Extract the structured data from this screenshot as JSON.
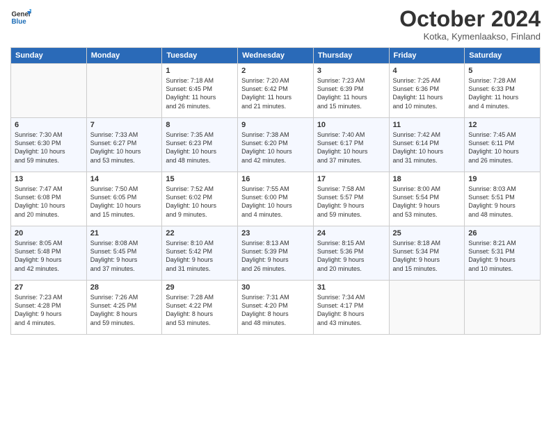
{
  "header": {
    "logo_general": "General",
    "logo_blue": "Blue",
    "month_title": "October 2024",
    "location": "Kotka, Kymenlaakso, Finland"
  },
  "columns": [
    "Sunday",
    "Monday",
    "Tuesday",
    "Wednesday",
    "Thursday",
    "Friday",
    "Saturday"
  ],
  "weeks": [
    [
      {
        "day": "",
        "info": ""
      },
      {
        "day": "",
        "info": ""
      },
      {
        "day": "1",
        "info": "Sunrise: 7:18 AM\nSunset: 6:45 PM\nDaylight: 11 hours\nand 26 minutes."
      },
      {
        "day": "2",
        "info": "Sunrise: 7:20 AM\nSunset: 6:42 PM\nDaylight: 11 hours\nand 21 minutes."
      },
      {
        "day": "3",
        "info": "Sunrise: 7:23 AM\nSunset: 6:39 PM\nDaylight: 11 hours\nand 15 minutes."
      },
      {
        "day": "4",
        "info": "Sunrise: 7:25 AM\nSunset: 6:36 PM\nDaylight: 11 hours\nand 10 minutes."
      },
      {
        "day": "5",
        "info": "Sunrise: 7:28 AM\nSunset: 6:33 PM\nDaylight: 11 hours\nand 4 minutes."
      }
    ],
    [
      {
        "day": "6",
        "info": "Sunrise: 7:30 AM\nSunset: 6:30 PM\nDaylight: 10 hours\nand 59 minutes."
      },
      {
        "day": "7",
        "info": "Sunrise: 7:33 AM\nSunset: 6:27 PM\nDaylight: 10 hours\nand 53 minutes."
      },
      {
        "day": "8",
        "info": "Sunrise: 7:35 AM\nSunset: 6:23 PM\nDaylight: 10 hours\nand 48 minutes."
      },
      {
        "day": "9",
        "info": "Sunrise: 7:38 AM\nSunset: 6:20 PM\nDaylight: 10 hours\nand 42 minutes."
      },
      {
        "day": "10",
        "info": "Sunrise: 7:40 AM\nSunset: 6:17 PM\nDaylight: 10 hours\nand 37 minutes."
      },
      {
        "day": "11",
        "info": "Sunrise: 7:42 AM\nSunset: 6:14 PM\nDaylight: 10 hours\nand 31 minutes."
      },
      {
        "day": "12",
        "info": "Sunrise: 7:45 AM\nSunset: 6:11 PM\nDaylight: 10 hours\nand 26 minutes."
      }
    ],
    [
      {
        "day": "13",
        "info": "Sunrise: 7:47 AM\nSunset: 6:08 PM\nDaylight: 10 hours\nand 20 minutes."
      },
      {
        "day": "14",
        "info": "Sunrise: 7:50 AM\nSunset: 6:05 PM\nDaylight: 10 hours\nand 15 minutes."
      },
      {
        "day": "15",
        "info": "Sunrise: 7:52 AM\nSunset: 6:02 PM\nDaylight: 10 hours\nand 9 minutes."
      },
      {
        "day": "16",
        "info": "Sunrise: 7:55 AM\nSunset: 6:00 PM\nDaylight: 10 hours\nand 4 minutes."
      },
      {
        "day": "17",
        "info": "Sunrise: 7:58 AM\nSunset: 5:57 PM\nDaylight: 9 hours\nand 59 minutes."
      },
      {
        "day": "18",
        "info": "Sunrise: 8:00 AM\nSunset: 5:54 PM\nDaylight: 9 hours\nand 53 minutes."
      },
      {
        "day": "19",
        "info": "Sunrise: 8:03 AM\nSunset: 5:51 PM\nDaylight: 9 hours\nand 48 minutes."
      }
    ],
    [
      {
        "day": "20",
        "info": "Sunrise: 8:05 AM\nSunset: 5:48 PM\nDaylight: 9 hours\nand 42 minutes."
      },
      {
        "day": "21",
        "info": "Sunrise: 8:08 AM\nSunset: 5:45 PM\nDaylight: 9 hours\nand 37 minutes."
      },
      {
        "day": "22",
        "info": "Sunrise: 8:10 AM\nSunset: 5:42 PM\nDaylight: 9 hours\nand 31 minutes."
      },
      {
        "day": "23",
        "info": "Sunrise: 8:13 AM\nSunset: 5:39 PM\nDaylight: 9 hours\nand 26 minutes."
      },
      {
        "day": "24",
        "info": "Sunrise: 8:15 AM\nSunset: 5:36 PM\nDaylight: 9 hours\nand 20 minutes."
      },
      {
        "day": "25",
        "info": "Sunrise: 8:18 AM\nSunset: 5:34 PM\nDaylight: 9 hours\nand 15 minutes."
      },
      {
        "day": "26",
        "info": "Sunrise: 8:21 AM\nSunset: 5:31 PM\nDaylight: 9 hours\nand 10 minutes."
      }
    ],
    [
      {
        "day": "27",
        "info": "Sunrise: 7:23 AM\nSunset: 4:28 PM\nDaylight: 9 hours\nand 4 minutes."
      },
      {
        "day": "28",
        "info": "Sunrise: 7:26 AM\nSunset: 4:25 PM\nDaylight: 8 hours\nand 59 minutes."
      },
      {
        "day": "29",
        "info": "Sunrise: 7:28 AM\nSunset: 4:22 PM\nDaylight: 8 hours\nand 53 minutes."
      },
      {
        "day": "30",
        "info": "Sunrise: 7:31 AM\nSunset: 4:20 PM\nDaylight: 8 hours\nand 48 minutes."
      },
      {
        "day": "31",
        "info": "Sunrise: 7:34 AM\nSunset: 4:17 PM\nDaylight: 8 hours\nand 43 minutes."
      },
      {
        "day": "",
        "info": ""
      },
      {
        "day": "",
        "info": ""
      }
    ]
  ]
}
